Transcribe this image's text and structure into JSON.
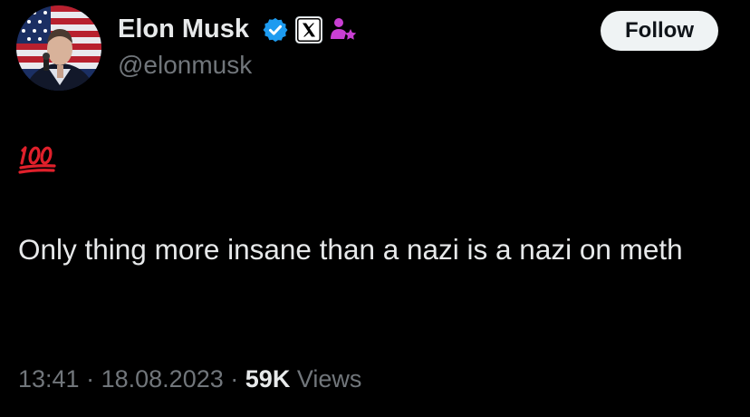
{
  "author": {
    "display_name": "Elon Musk",
    "handle": "@elonmusk",
    "avatar_icon": "profile-photo-american-flag",
    "badges": [
      "verified-icon",
      "x-affiliate-icon",
      "person-star-icon"
    ]
  },
  "follow_label": "Follow",
  "tweet": {
    "emoji_icon": "hundred-points-emoji",
    "text": "Only thing more insane than a nazi is a nazi on meth"
  },
  "meta": {
    "time": "13:41",
    "separator": "·",
    "date": "18.08.2023",
    "views_count": "59K",
    "views_label": "Views"
  },
  "colors": {
    "background": "#000000",
    "primary_text": "#e7e9ea",
    "secondary_text": "#71767b",
    "verified_blue": "#1d9bf0",
    "follow_button_bg": "#eff3f4",
    "emoji_red": "#e0202b",
    "badge_purple": "#c93fd3"
  }
}
